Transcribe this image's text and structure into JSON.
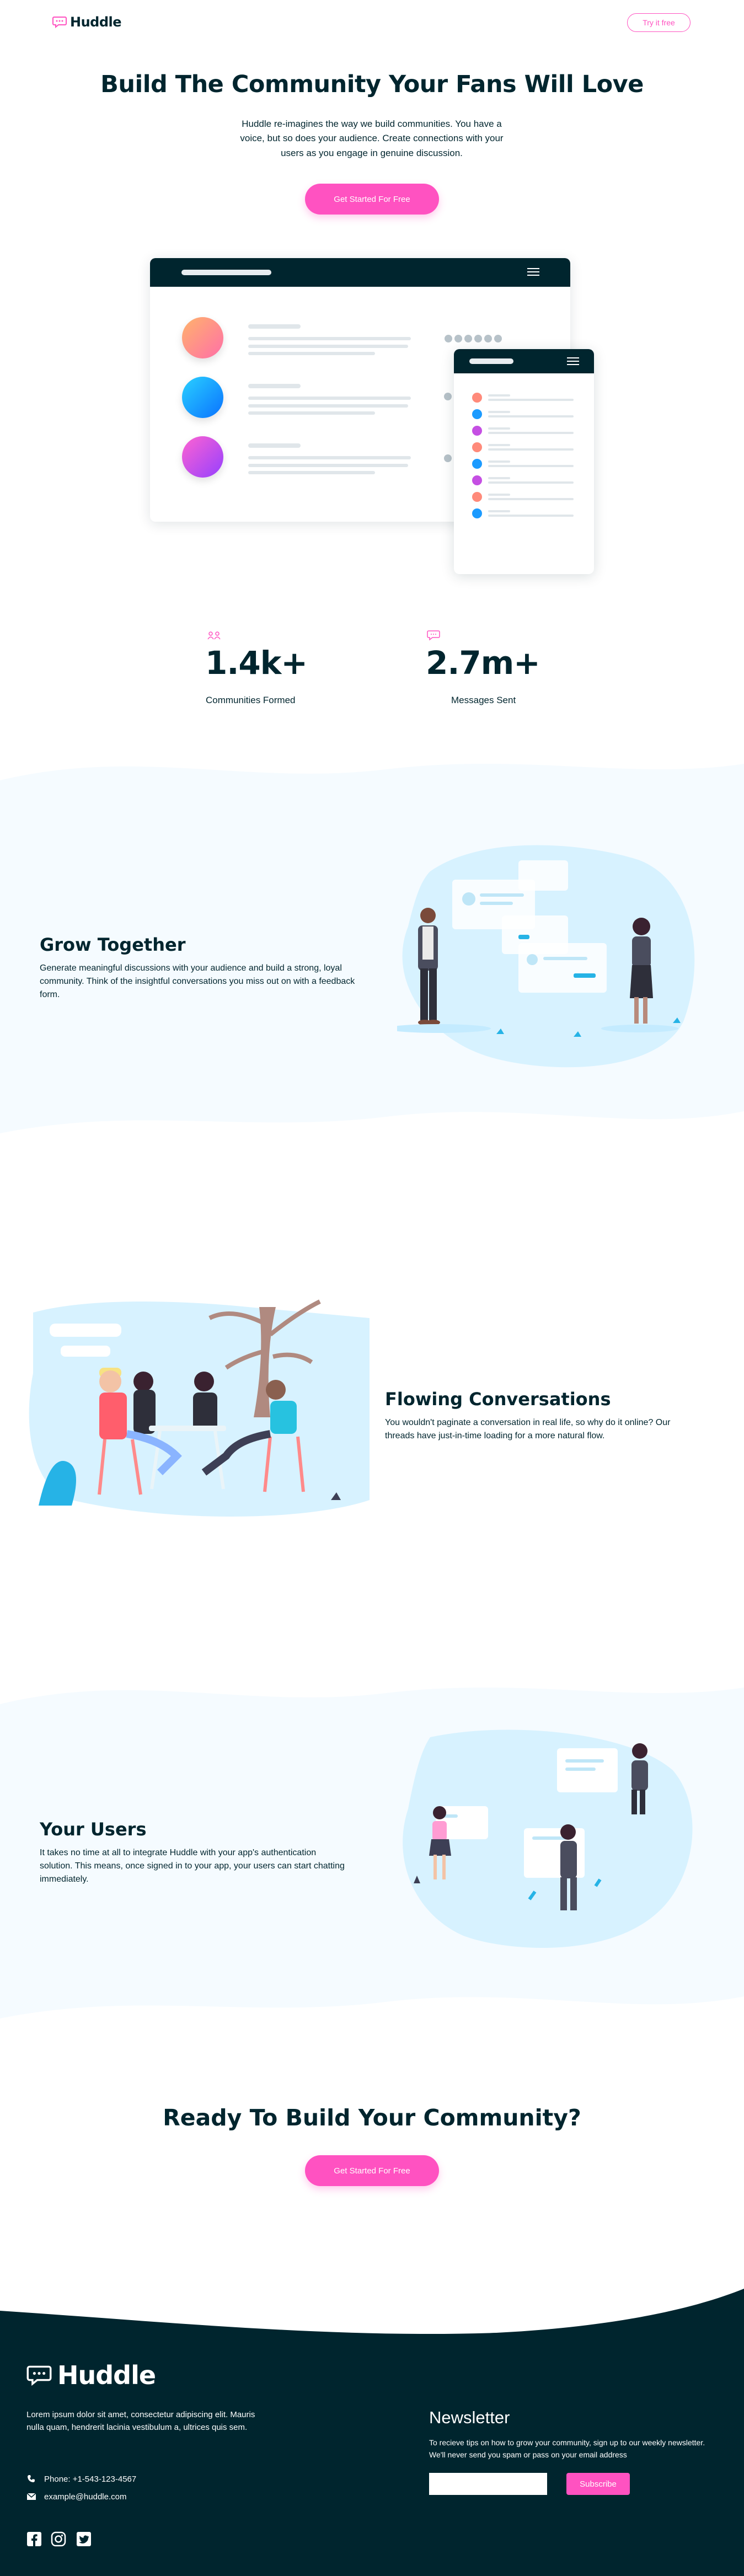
{
  "brand": {
    "name": "Huddle"
  },
  "header": {
    "try_label": "Try it free"
  },
  "hero": {
    "title": "Build The Community Your Fans Will Love",
    "subtitle": "Huddle re-imagines the way we build communities. You have a voice, but so does your audience. Create connections with your users as you engage in genuine discussion.",
    "cta": "Get Started For Free"
  },
  "stats": [
    {
      "icon": "communities-icon",
      "value": "1.4k+",
      "label": "Communities Formed"
    },
    {
      "icon": "messages-icon",
      "value": "2.7m+",
      "label": "Messages Sent"
    }
  ],
  "features": [
    {
      "title": "Grow Together",
      "text": "Generate meaningful discussions with your audience and build a strong, loyal community. Think of the insightful conversations you miss out on with a feedback form."
    },
    {
      "title": "Flowing Conversations",
      "text": "You wouldn't paginate a conversation in real life, so why do it online? Our threads have just-in-time loading for a more natural flow."
    },
    {
      "title": "Your Users",
      "text": "It takes no time at all to integrate Huddle with your app's authentication solution. This means, once signed in to your app, your users can start chatting immediately."
    }
  ],
  "cta_section": {
    "title": "Ready To Build Your Community?",
    "button": "Get Started For Free"
  },
  "footer": {
    "about": "Lorem ipsum dolor sit amet, consectetur adipiscing elit. Mauris nulla quam, hendrerit lacinia vestibulum a, ultrices quis sem.",
    "phone": "Phone: +1-543-123-4567",
    "email": "example@huddle.com",
    "newsletter_title": "Newsletter",
    "newsletter_text": "To recieve tips on how to grow your community, sign up to our weekly newsletter. We'll never send you spam or pass on your email address",
    "subscribe": "Subscribe",
    "socials": [
      "facebook-icon",
      "instagram-icon",
      "twitter-icon"
    ]
  },
  "colors": {
    "pink": "#ff52c1",
    "dark": "#00252e",
    "light_blue": "#f5fbff"
  }
}
